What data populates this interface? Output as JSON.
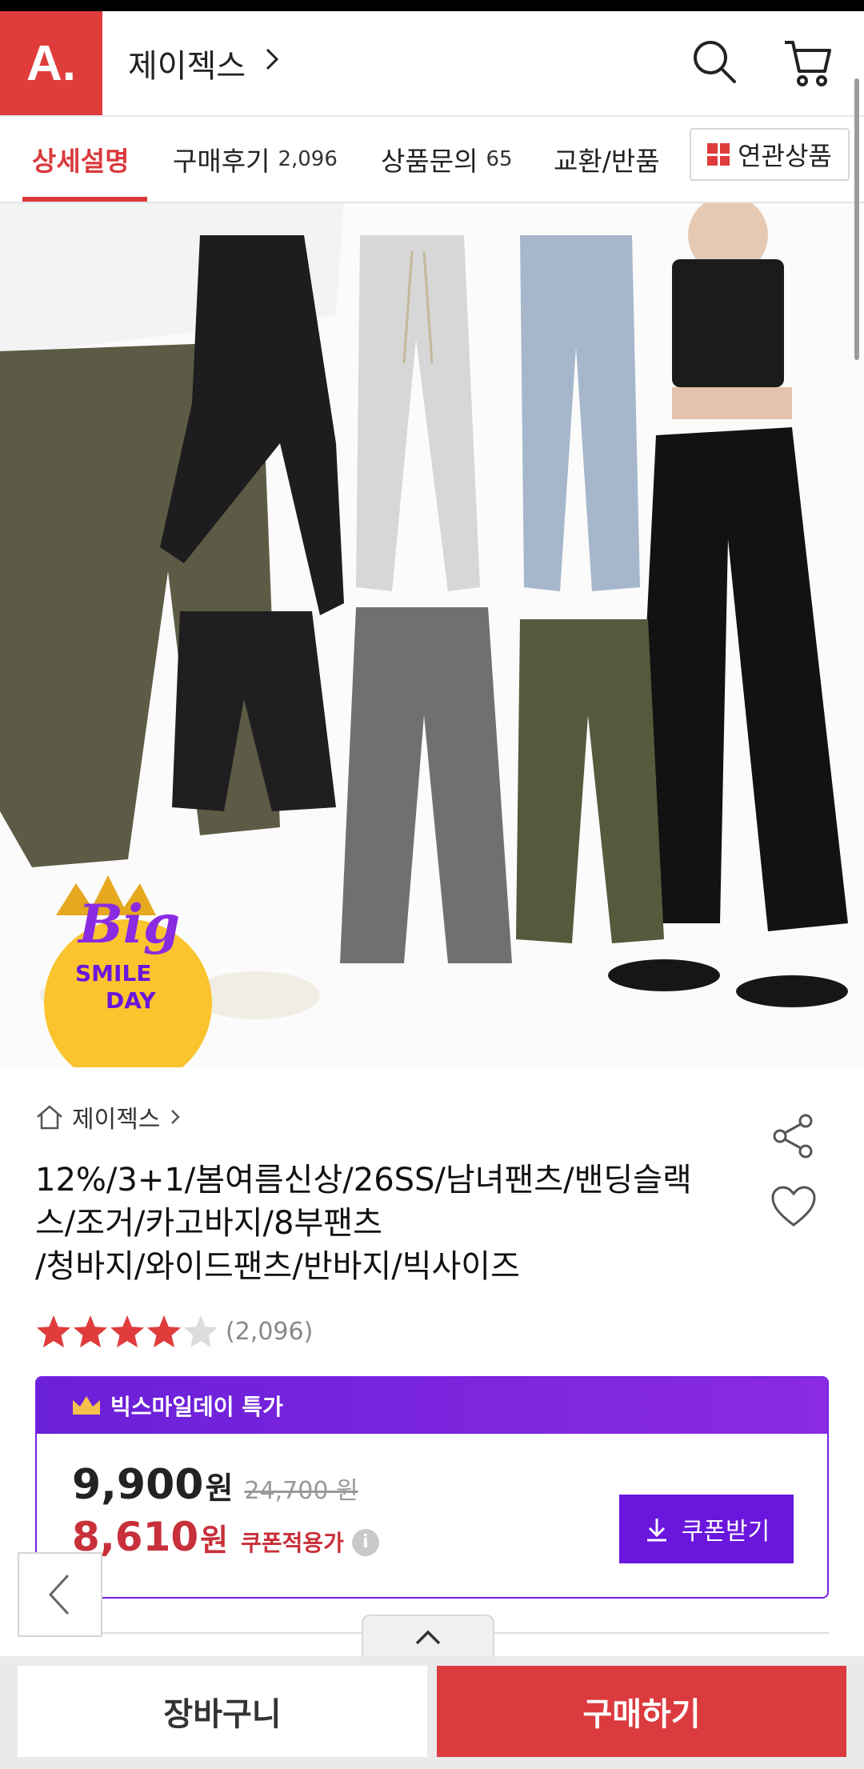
{
  "header": {
    "logo_text": "A.",
    "store_name": "제이젝스",
    "store_chevron": "›"
  },
  "tabs": [
    {
      "label": "상세설명",
      "count": ""
    },
    {
      "label": "구매후기",
      "count": "2,096"
    },
    {
      "label": "상품문의",
      "count": "65"
    },
    {
      "label": "교환/반품",
      "count": ""
    }
  ],
  "related_products_label": "연관상품",
  "hero": {
    "badge_big": "Big",
    "badge_smile": "SMILE",
    "badge_day": "DAY"
  },
  "product": {
    "breadcrumb": "제이젝스",
    "title_lines": [
      "12%/3+1/봄여름신상/26SS/남녀팬츠/밴딩슬랙",
      "스/조거/카고바지/8부팬츠",
      "/청바지/와이드팬츠/반바지/빅사이즈"
    ],
    "rating_stars": 4,
    "rating_max": 5,
    "rating_count": "(2,096)"
  },
  "deal": {
    "header_label": "빅스마일데이 특가",
    "price": "9,900",
    "price_unit": "원",
    "original_price": "24,700 원",
    "coupon_price": "8,610",
    "coupon_unit": "원",
    "coupon_label": "쿠폰적용가",
    "coupon_button": "쿠폰받기"
  },
  "bottom": {
    "cart_label": "장바구니",
    "buy_label": "구매하기"
  },
  "colors": {
    "brand_red": "#e03c3c",
    "deal_purple": "#6a16dc",
    "coupon_red": "#c8303a"
  }
}
